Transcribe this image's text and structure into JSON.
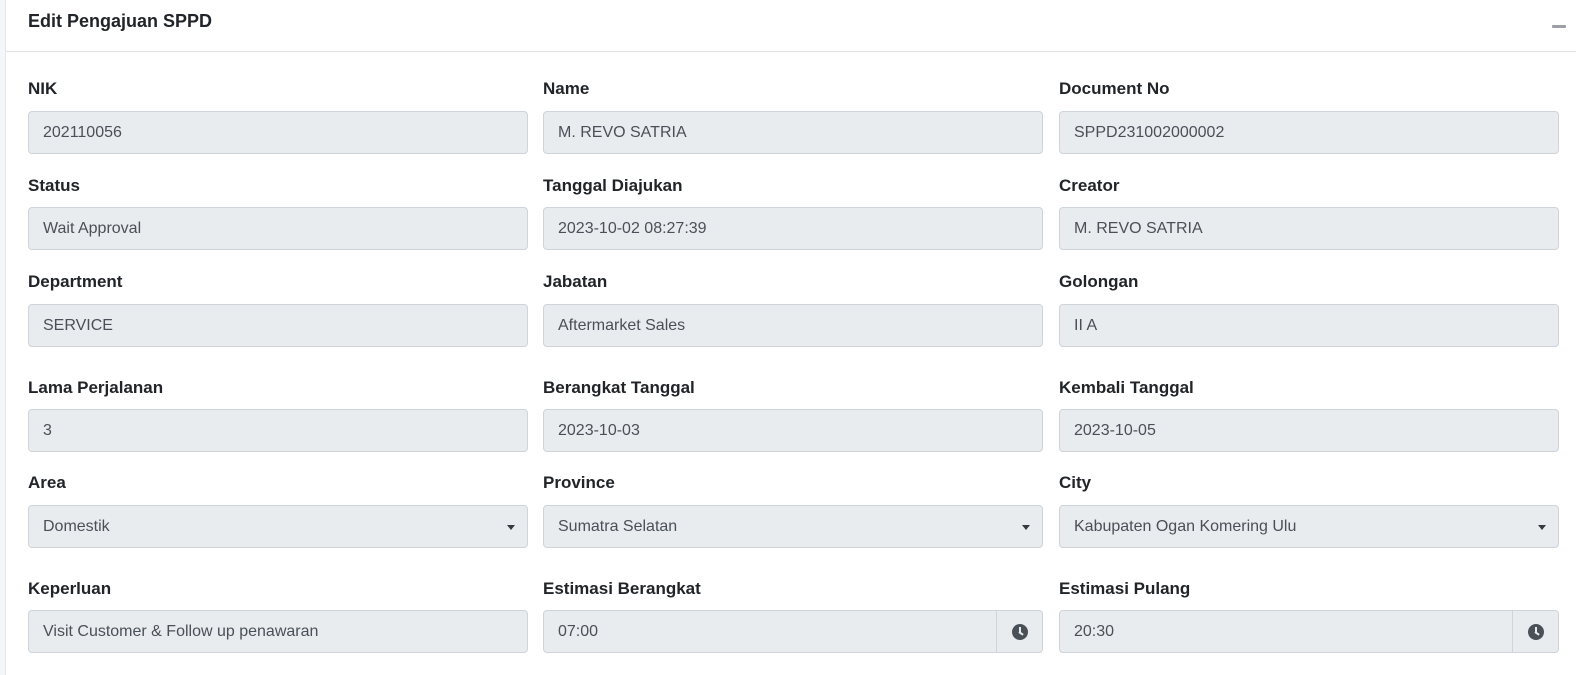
{
  "card": {
    "title": "Edit Pengajuan SPPD"
  },
  "fields": {
    "nik": {
      "label": "NIK",
      "value": "202110056"
    },
    "name": {
      "label": "Name",
      "value": "M. REVO SATRIA"
    },
    "document_no": {
      "label": "Document No",
      "value": "SPPD231002000002"
    },
    "status": {
      "label": "Status",
      "value": "Wait Approval"
    },
    "tanggal_diajukan": {
      "label": "Tanggal Diajukan",
      "value": "2023-10-02 08:27:39"
    },
    "creator": {
      "label": "Creator",
      "value": "M. REVO SATRIA"
    },
    "department": {
      "label": "Department",
      "value": "SERVICE"
    },
    "jabatan": {
      "label": "Jabatan",
      "value": "Aftermarket Sales"
    },
    "golongan": {
      "label": "Golongan",
      "value": "II A"
    },
    "lama_perjalanan": {
      "label": "Lama Perjalanan",
      "value": "3"
    },
    "berangkat_tanggal": {
      "label": "Berangkat Tanggal",
      "value": "2023-10-03"
    },
    "kembali_tanggal": {
      "label": "Kembali Tanggal",
      "value": "2023-10-05"
    },
    "area": {
      "label": "Area",
      "value": "Domestik"
    },
    "province": {
      "label": "Province",
      "value": "Sumatra Selatan"
    },
    "city": {
      "label": "City",
      "value": "Kabupaten Ogan Komering Ulu"
    },
    "keperluan": {
      "label": "Keperluan",
      "value": "Visit Customer & Follow up penawaran"
    },
    "estimasi_berangkat": {
      "label": "Estimasi Berangkat",
      "value": "07:00"
    },
    "estimasi_pulang": {
      "label": "Estimasi Pulang",
      "value": "20:30"
    }
  },
  "icons": {
    "collapse": "minus-icon",
    "select_caret": "caret-down-icon",
    "time": "clock-icon"
  },
  "colors": {
    "input_bg": "#e9ecef",
    "input_border": "#ced4da",
    "text": "#212529",
    "input_text": "#495057"
  }
}
